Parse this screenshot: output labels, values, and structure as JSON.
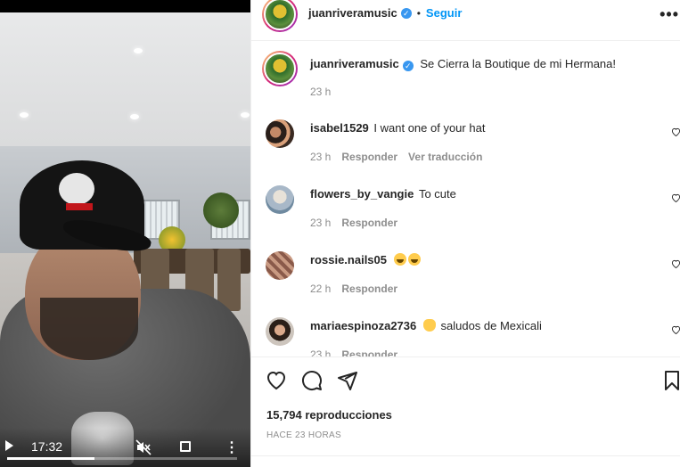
{
  "video": {
    "time": "17:32",
    "progress_fraction": 0.38
  },
  "header": {
    "username": "juanriveramusic",
    "verified": "✓",
    "separator": "•",
    "follow_label": "Seguir",
    "more_label": "•••"
  },
  "caption": {
    "username": "juanriveramusic",
    "text": "Se Cierra la Boutique de mi Hermana!",
    "time": "23 h"
  },
  "comments": [
    {
      "username": "isabel1529",
      "text": "I want one of your hat",
      "time": "23 h",
      "reply": "Responder",
      "translate": "Ver traducción"
    },
    {
      "username": "flowers_by_vangie",
      "text": "To cute",
      "time": "23 h",
      "reply": "Responder"
    },
    {
      "username": "rossie.nails05",
      "text": "",
      "time": "22 h",
      "reply": "Responder",
      "emojis": [
        "laughing-emoji",
        "laughing-emoji"
      ]
    },
    {
      "username": "mariaespinoza2736",
      "text": "saludos de Mexicali",
      "time": "23 h",
      "reply": "Responder",
      "emojis": [
        "clapping-hands-emoji"
      ]
    }
  ],
  "footer": {
    "views": "15,794 reproducciones",
    "ago": "HACE 23 HORAS"
  },
  "colors": {
    "follow_blue": "#0095f6",
    "verified_blue": "#3897f0",
    "muted_gray": "#8e8e8e"
  }
}
